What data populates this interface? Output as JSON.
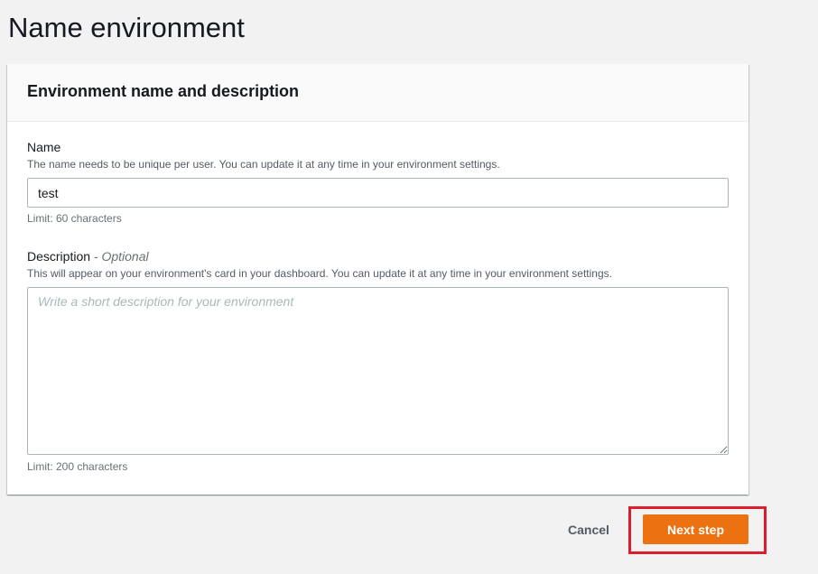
{
  "page": {
    "title": "Name environment"
  },
  "card": {
    "title": "Environment name and description",
    "name_field": {
      "label": "Name",
      "description": "The name needs to be unique per user. You can update it at any time in your environment settings.",
      "value": "test",
      "constraint": "Limit: 60 characters"
    },
    "description_field": {
      "label": "Description",
      "optional_label": " - Optional",
      "description": "This will appear on your environment's card in your dashboard. You can update it at any time in your environment settings.",
      "placeholder": "Write a short description for your environment",
      "value": "",
      "constraint": "Limit: 200 characters"
    }
  },
  "actions": {
    "cancel_label": "Cancel",
    "next_label": "Next step"
  },
  "colors": {
    "primary_button": "#ec7211",
    "highlight_outline": "#dd1c2c",
    "page_background": "#f2f2f2"
  }
}
